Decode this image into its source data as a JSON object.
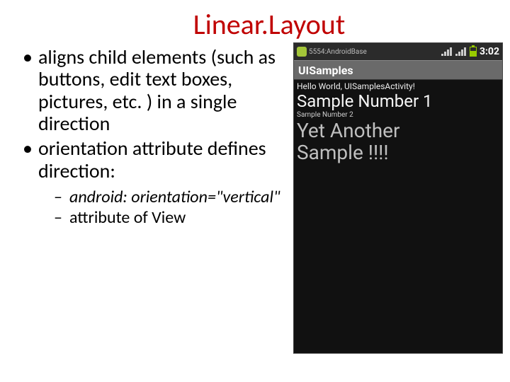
{
  "title": "Linear.Layout",
  "bullets": [
    "aligns child elements (such as buttons, edit text boxes, pictures, etc. ) in a single direction",
    "orientation attribute defines direction:"
  ],
  "sub_bullets": [
    "android: orientation=\"vertical\"",
    "attribute of View"
  ],
  "phone": {
    "status": {
      "app_hint": "5554:AndroidBase",
      "clock": "3:02"
    },
    "titlebar": "UISamples",
    "lines": {
      "hello": "Hello World, UISamplesActivity!",
      "sample1": "Sample Number 1",
      "sample2": "Sample Number 2",
      "sample3a": "Yet Another",
      "sample3b": "Sample !!!!"
    }
  }
}
